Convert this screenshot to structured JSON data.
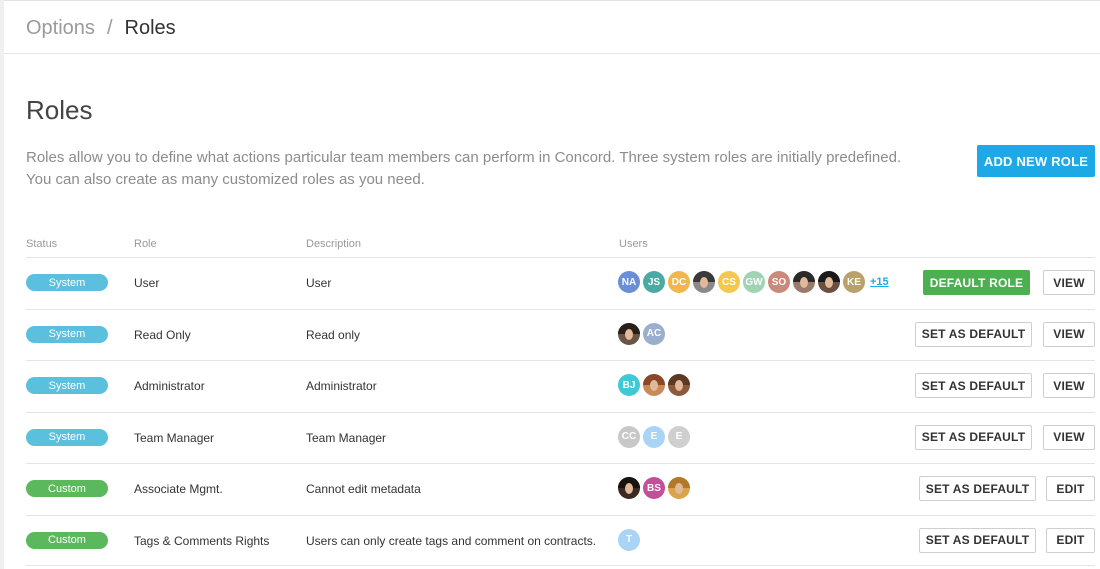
{
  "breadcrumb": {
    "parent": "Options",
    "separator": "/",
    "current": "Roles"
  },
  "page": {
    "title": "Roles",
    "intro_line1": "Roles allow you to define what actions particular team members can perform in Concord. Three system roles are initially predefined.",
    "intro_line2": "You can also create as many customized roles as you need.",
    "add_button": "ADD NEW ROLE"
  },
  "colors": {
    "accent": "#1ca9e6",
    "system_badge": "#5bc0de",
    "custom_badge": "#5cb85c",
    "default_role": "#4caf50"
  },
  "table": {
    "headers": {
      "status": "Status",
      "role": "Role",
      "description": "Description",
      "users": "Users"
    },
    "rows": [
      {
        "status": "System",
        "status_type": "system",
        "role": "User",
        "description": "User",
        "users": [
          {
            "initials": "NA",
            "color": "#6b8fd6"
          },
          {
            "initials": "JS",
            "color": "#4caaa4"
          },
          {
            "initials": "DC",
            "color": "#f0b84a"
          },
          {
            "initials": "",
            "photo": true,
            "color": "#8a8a8a",
            "hair": "#3a3a3a"
          },
          {
            "initials": "CS",
            "color": "#f2c94c"
          },
          {
            "initials": "GW",
            "color": "#9fd3b4"
          },
          {
            "initials": "SO",
            "color": "#c98a7a"
          },
          {
            "initials": "",
            "photo": true,
            "color": "#9a7a6a",
            "hair": "#2a2a2a"
          },
          {
            "initials": "",
            "photo": true,
            "color": "#6a5040",
            "hair": "#1a1a1a"
          },
          {
            "initials": "KE",
            "color": "#b9a26a"
          }
        ],
        "more": "+15",
        "primary_label": "DEFAULT ROLE",
        "primary_is_default": true,
        "secondary_label": "VIEW"
      },
      {
        "status": "System",
        "status_type": "system",
        "role": "Read Only",
        "description": "Read only",
        "users": [
          {
            "initials": "",
            "photo": true,
            "color": "#6a5446",
            "hair": "#2a1e18"
          },
          {
            "initials": "AC",
            "color": "#9aaecf"
          }
        ],
        "more": "",
        "primary_label": "SET AS DEFAULT",
        "primary_is_default": false,
        "secondary_label": "VIEW"
      },
      {
        "status": "System",
        "status_type": "system",
        "role": "Administrator",
        "description": "Administrator",
        "users": [
          {
            "initials": "BJ",
            "color": "#3fc8d6"
          },
          {
            "initials": "",
            "photo": true,
            "color": "#c98a5a",
            "hair": "#8a4a2a"
          },
          {
            "initials": "",
            "photo": true,
            "color": "#8a5a3a",
            "hair": "#5a3a22"
          }
        ],
        "more": "",
        "primary_label": "SET AS DEFAULT",
        "primary_is_default": false,
        "secondary_label": "VIEW"
      },
      {
        "status": "System",
        "status_type": "system",
        "role": "Team Manager",
        "description": "Team Manager",
        "users": [
          {
            "initials": "CC",
            "color": "#c8c8c8"
          },
          {
            "initials": "E",
            "color": "#a9d4f5"
          },
          {
            "initials": "E",
            "color": "#cfcfcf"
          }
        ],
        "more": "",
        "primary_label": "SET AS DEFAULT",
        "primary_is_default": false,
        "secondary_label": "VIEW"
      },
      {
        "status": "Custom",
        "status_type": "custom",
        "role": "Associate Mgmt.",
        "description": "Cannot edit metadata",
        "users": [
          {
            "initials": "",
            "photo": true,
            "color": "#3a2a22",
            "hair": "#1a1210"
          },
          {
            "initials": "BS",
            "color": "#c24f9a"
          },
          {
            "initials": "",
            "photo": true,
            "color": "#d9a44a",
            "hair": "#b07a2a"
          }
        ],
        "more": "",
        "primary_label": "SET AS DEFAULT",
        "primary_is_default": false,
        "secondary_label": "EDIT"
      },
      {
        "status": "Custom",
        "status_type": "custom",
        "role": "Tags & Comments Rights",
        "description": "Users can only create tags and comment on contracts.",
        "users": [
          {
            "initials": "T",
            "color": "#a9d4f5"
          }
        ],
        "more": "",
        "primary_label": "SET AS DEFAULT",
        "primary_is_default": false,
        "secondary_label": "EDIT"
      }
    ]
  }
}
